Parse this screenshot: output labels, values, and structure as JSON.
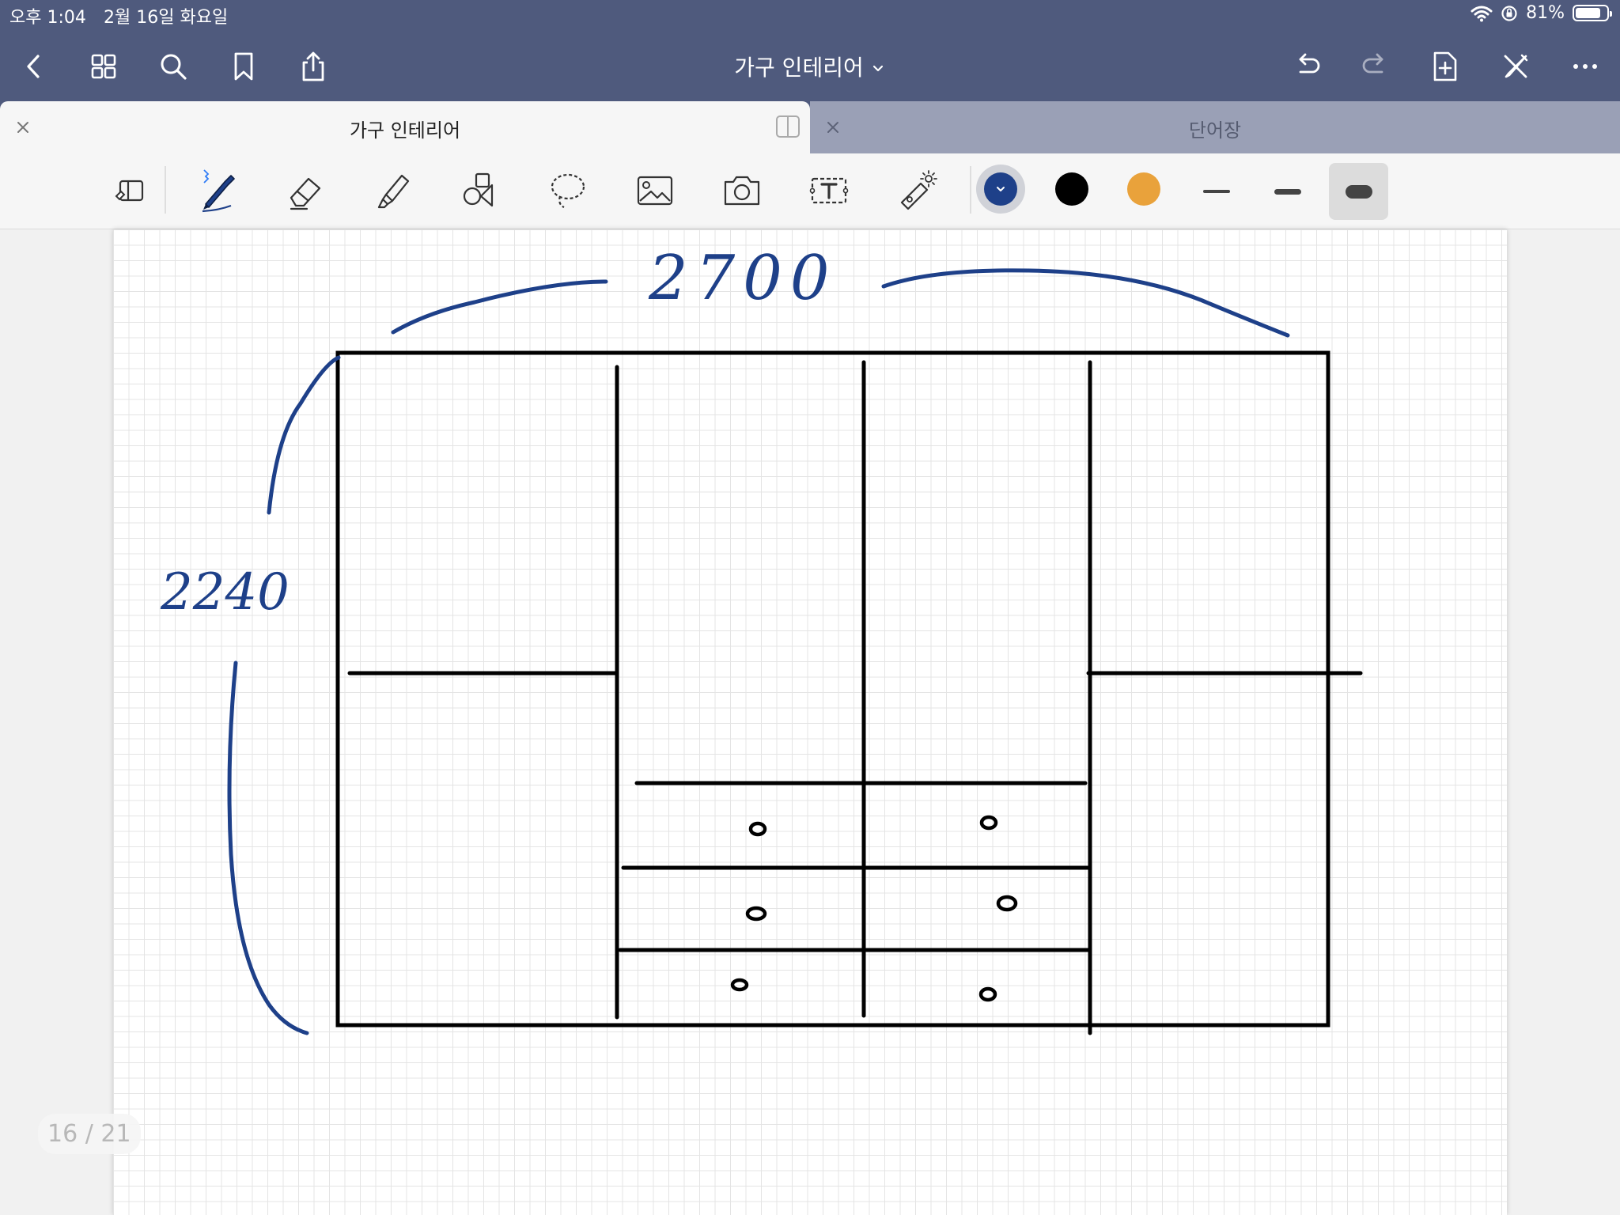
{
  "status_bar": {
    "time": "오후 1:04",
    "date": "2월 16일 화요일",
    "battery": "81%",
    "battery_level": 0.81
  },
  "nav": {
    "title": "가구 인테리어",
    "icons": [
      "back-icon",
      "grid-icon",
      "search-icon",
      "bookmark-icon",
      "share-icon",
      "undo-icon",
      "redo-icon",
      "add-page-icon",
      "close-tools-icon",
      "more-icon"
    ]
  },
  "tabs": [
    {
      "label": "가구 인테리어",
      "active": true
    },
    {
      "label": "단어장",
      "active": false
    }
  ],
  "toolbar": {
    "tools": [
      "read-only-icon",
      "pen-icon",
      "eraser-icon",
      "highlighter-icon",
      "shapes-icon",
      "lasso-icon",
      "image-icon",
      "camera-icon",
      "text-icon",
      "laser-pointer-icon"
    ],
    "active_tool": "pen",
    "colors": [
      "#1e4089",
      "#000000",
      "#e9a23b"
    ],
    "selected_color": "#1e4089",
    "stroke_sizes": [
      "thin",
      "medium",
      "thick"
    ],
    "selected_stroke": "thick"
  },
  "canvas": {
    "handwriting": {
      "width_label": "2700",
      "height_label": "2240",
      "drawer_marks": [
        "o",
        "o",
        "o",
        "o",
        "o",
        "o"
      ]
    }
  },
  "page_counter": "16 / 21"
}
